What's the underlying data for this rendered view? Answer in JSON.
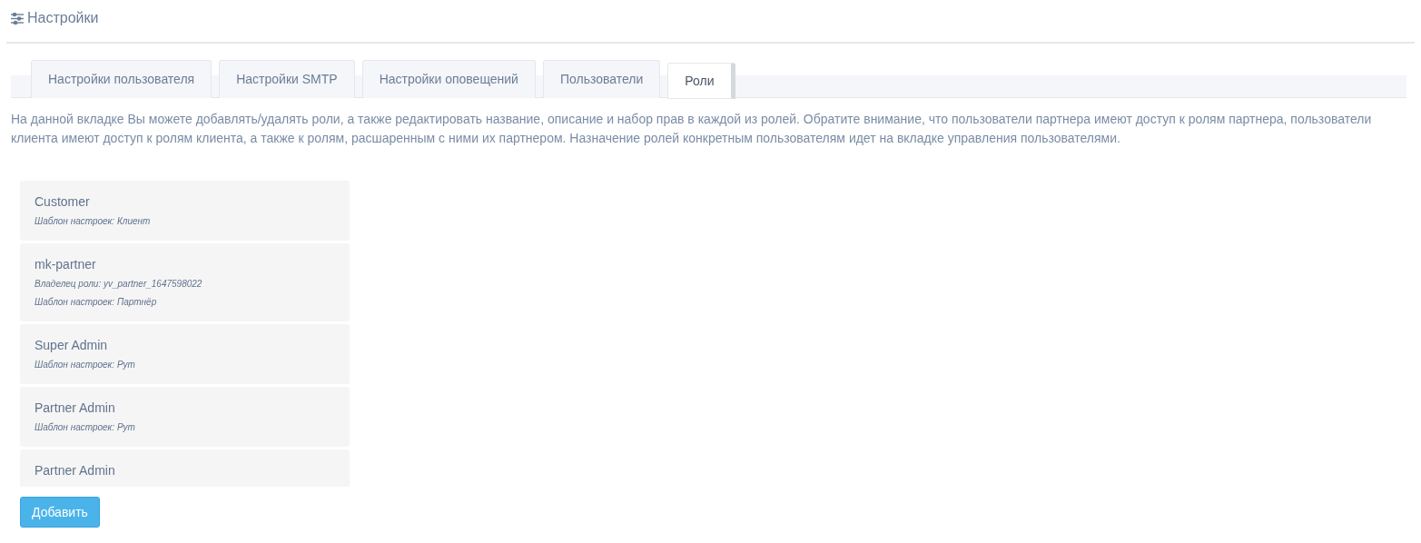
{
  "header": {
    "title": "Настройки"
  },
  "tabs": [
    {
      "label": "Настройки пользователя",
      "selected": false
    },
    {
      "label": "Настройки SMTP",
      "selected": false
    },
    {
      "label": "Настройки оповещений",
      "selected": false
    },
    {
      "label": "Пользователи",
      "selected": false
    },
    {
      "label": "Роли",
      "selected": true
    }
  ],
  "description": "На данной вкладке Вы можете добавлять/удалять роли, а также редактировать название, описание и набор прав в каждой из ролей. Обратите внимание, что пользователи партнера имеют доступ к ролям партнера, пользователи клиента имеют доступ к ролям клиента, а также к ролям, расшаренным с ними их партнером. Назначение ролей конкретным пользователям идет на вкладке управления пользователями.",
  "roles": [
    {
      "name": "Customer",
      "details": [
        "Шаблон настроек: Клиент"
      ]
    },
    {
      "name": "mk-partner",
      "details": [
        "Владелец роли: yv_partner_1647598022",
        "Шаблон настроек: Партнёр"
      ]
    },
    {
      "name": "Super Admin",
      "details": [
        "Шаблон настроек: Рут"
      ]
    },
    {
      "name": "Partner Admin",
      "details": [
        "Шаблон настроек: Рут"
      ]
    },
    {
      "name": "Partner Admin"
    }
  ],
  "add_button": "Добавить"
}
